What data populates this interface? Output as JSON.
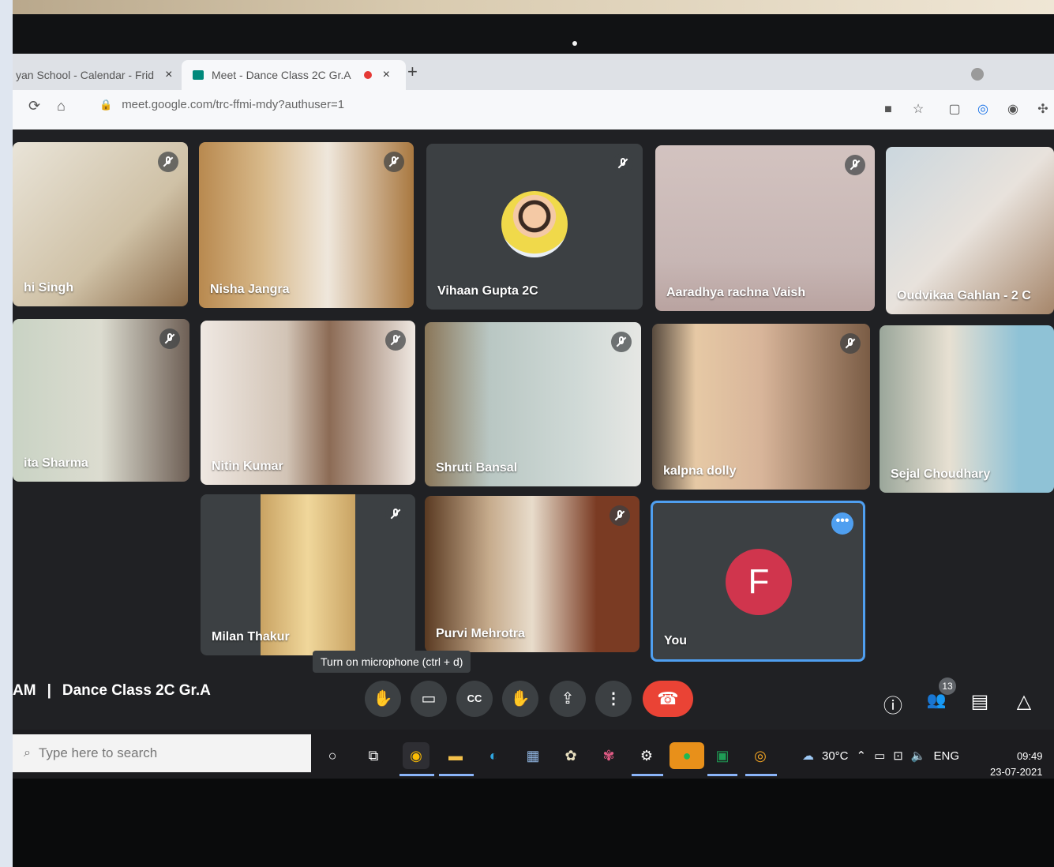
{
  "browser": {
    "tabs": [
      {
        "label": "yan School - Calendar - Frid",
        "close": "×"
      },
      {
        "label": "Meet - Dance Class 2C Gr.A",
        "close": "×"
      }
    ],
    "new_tab": "+",
    "url": "meet.google.com/trc-ffmi-mdy?authuser=1",
    "icons": [
      "reload-icon",
      "home-icon",
      "lock-icon",
      "camera-icon",
      "star-icon",
      "extension-icon",
      "profile-icon"
    ]
  },
  "participants": [
    {
      "name": "hi Singh",
      "muted": true
    },
    {
      "name": "Nisha Jangra",
      "muted": true
    },
    {
      "name": "Vihaan Gupta 2C",
      "muted": true
    },
    {
      "name": "Aaradhya rachna Vaish",
      "muted": true
    },
    {
      "name": "Oudvikaa Gahlan - 2 C",
      "muted": false
    },
    {
      "name": "ita Sharma",
      "muted": true
    },
    {
      "name": "Nitin Kumar",
      "muted": true
    },
    {
      "name": "Shruti Bansal",
      "muted": true
    },
    {
      "name": "kalpna dolly",
      "muted": true
    },
    {
      "name": "Sejal Choudhary",
      "muted": false
    },
    {
      "name": "Milan Thakur",
      "muted": true
    },
    {
      "name": "Purvi Mehrotra",
      "muted": true
    },
    {
      "name": "You",
      "avatar_letter": "F",
      "more": "•••"
    }
  ],
  "tooltip": "Turn on microphone (ctrl + d)",
  "meeting": {
    "time_suffix": "AM",
    "separator": "|",
    "title": "Dance Class 2C Gr.A"
  },
  "controls": [
    {
      "name": "microphone",
      "icon": "✋"
    },
    {
      "name": "camera",
      "icon": "▭"
    },
    {
      "name": "captions",
      "icon": "CC"
    },
    {
      "name": "raise-hand",
      "icon": "✋"
    },
    {
      "name": "present",
      "icon": "⇪"
    },
    {
      "name": "more-options",
      "icon": "⋮"
    }
  ],
  "end_call_icon": "☎",
  "right_controls": {
    "info": "ⓘ",
    "people_count": "13",
    "people": "👥",
    "chat": "▤",
    "activities": "△"
  },
  "taskbar": {
    "search_placeholder": "Type here to search",
    "weather": "30°C",
    "language": "ENG",
    "time": "09:49",
    "date": "23-07-2021"
  },
  "colors": {
    "meet_bg": "#202124",
    "end_call": "#ea4335",
    "you_border": "#4f9ff0",
    "avatar": "#d0354d"
  }
}
